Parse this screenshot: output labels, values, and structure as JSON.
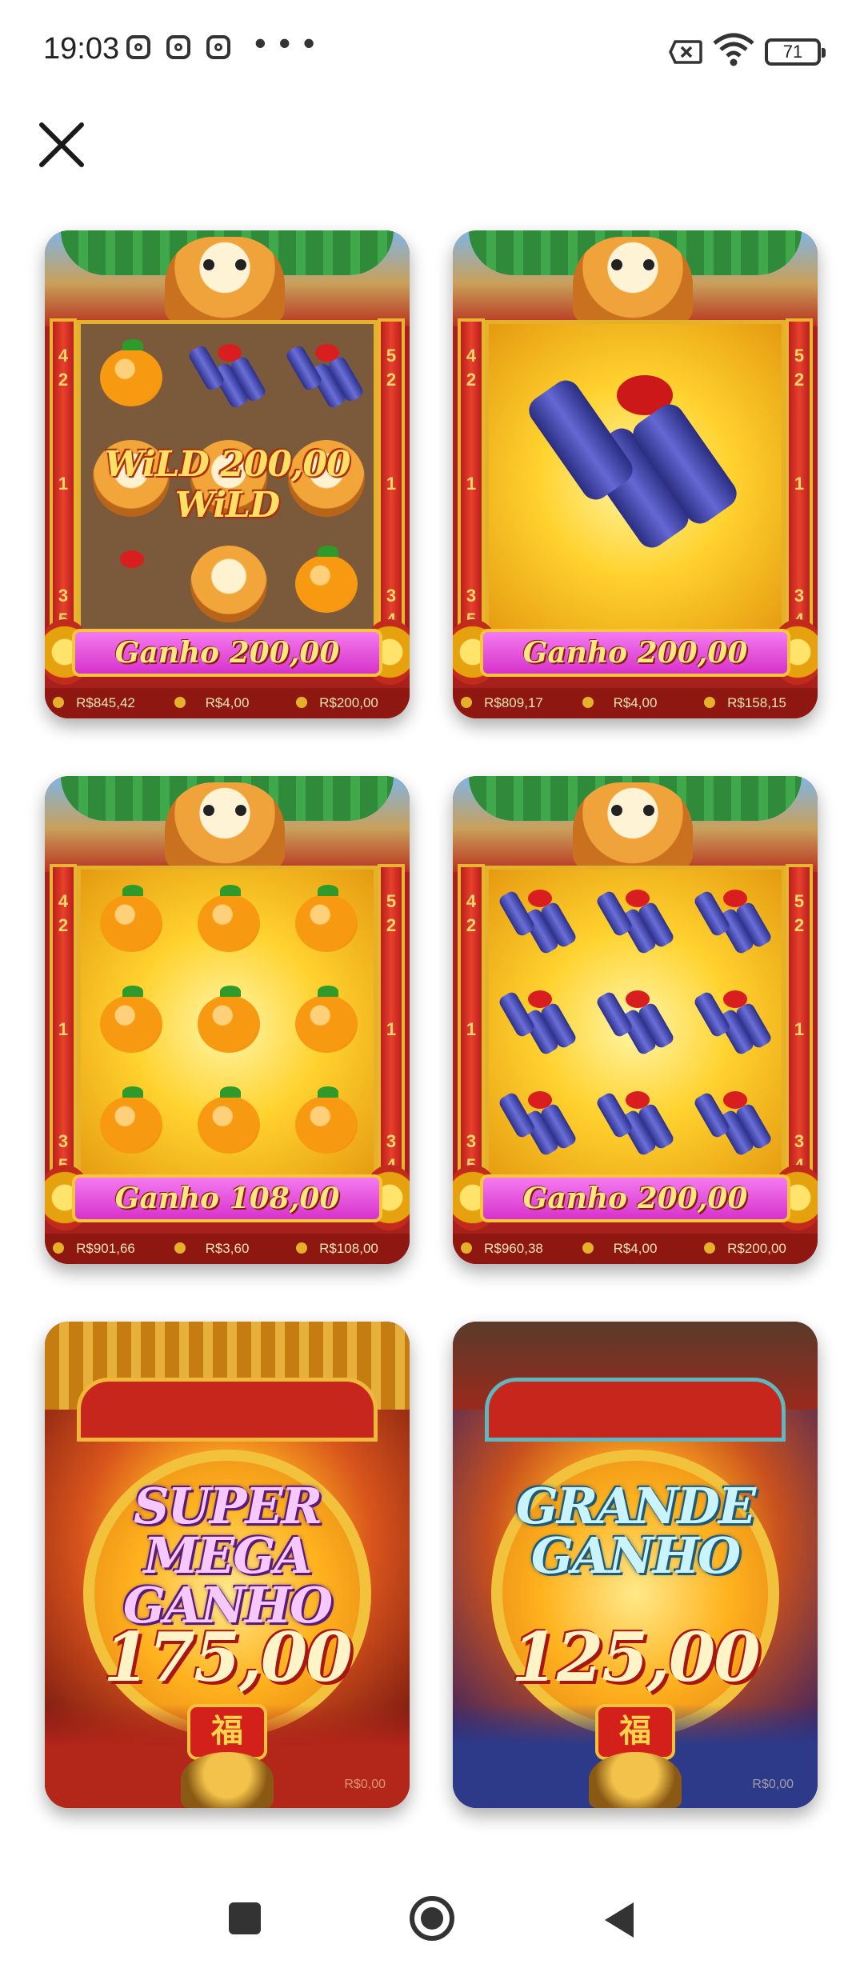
{
  "status_bar": {
    "time": "19:03",
    "notification_icons": [
      "instagram-icon",
      "instagram-icon",
      "instagram-icon"
    ],
    "more_indicator": "• • •",
    "battery_level": "71",
    "icons": [
      "no-sim-icon",
      "wifi-icon",
      "battery-icon"
    ]
  },
  "toolbar": {
    "close_icon": "close-icon"
  },
  "cards": [
    {
      "type": "slot",
      "overlay_text": "WiLD 200,00 WiLD",
      "win_label": "Ganho 200,00",
      "balance": "R$845,42",
      "bet": "R$4,00",
      "win": "R$200,00",
      "left_numbers": [
        "4",
        "2",
        "1",
        "3",
        "5"
      ],
      "right_numbers": [
        "5",
        "2",
        "1",
        "3",
        "4"
      ]
    },
    {
      "type": "slot",
      "win_label": "Ganho 200,00",
      "balance": "R$809,17",
      "bet": "R$4,00",
      "win": "R$158,15",
      "left_numbers": [
        "4",
        "2",
        "1",
        "3",
        "5"
      ],
      "right_numbers": [
        "5",
        "2",
        "1",
        "3",
        "4"
      ]
    },
    {
      "type": "slot",
      "win_label": "Ganho 108,00",
      "balance": "R$901,66",
      "bet": "R$3,60",
      "win": "R$108,00",
      "left_numbers": [
        "4",
        "2",
        "1",
        "3",
        "5"
      ],
      "right_numbers": [
        "5",
        "2",
        "1",
        "3",
        "4"
      ]
    },
    {
      "type": "slot",
      "win_label": "Ganho 200,00",
      "balance": "R$960,38",
      "bet": "R$4,00",
      "win": "R$200,00",
      "left_numbers": [
        "4",
        "2",
        "1",
        "3",
        "5"
      ],
      "right_numbers": [
        "5",
        "2",
        "1",
        "3",
        "4"
      ]
    },
    {
      "type": "big-win",
      "title_line1": "SUPER",
      "title_line2": "MEGA GANHO",
      "amount": "175,00",
      "emblem": "福",
      "bottom_right": "R$0,00"
    },
    {
      "type": "big-win",
      "title_line1": "GRANDE",
      "title_line2": "GANHO",
      "amount": "125,00",
      "emblem": "福",
      "bottom_right": "R$0,00"
    }
  ],
  "nav_bar": {
    "recents": "recents-icon",
    "home": "home-icon",
    "back": "back-icon"
  }
}
